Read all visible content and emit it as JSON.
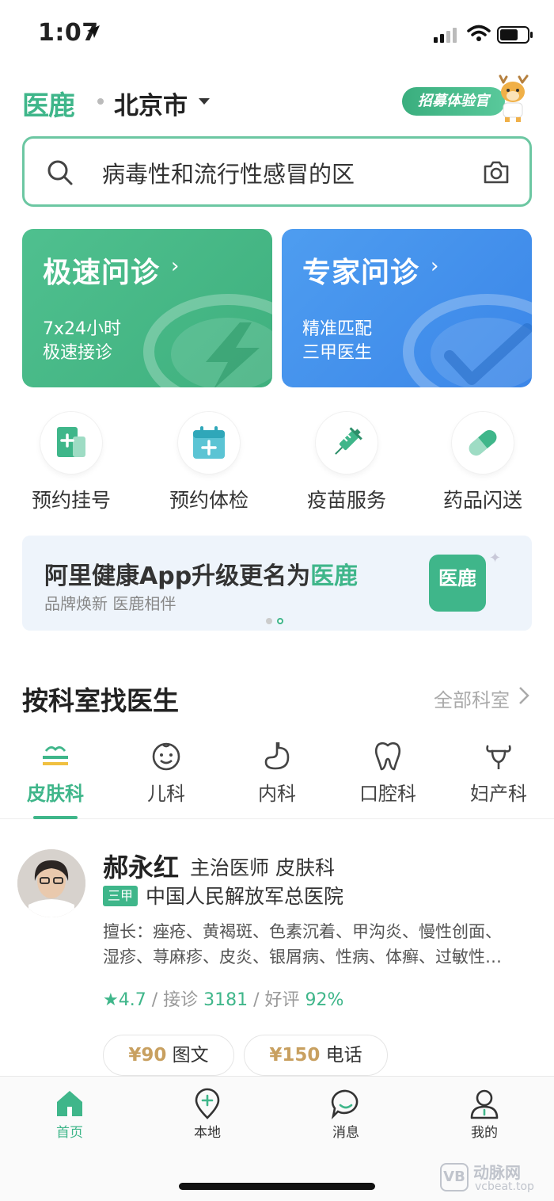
{
  "status_bar": {
    "time": "1:07"
  },
  "header": {
    "logo": "医鹿",
    "city": "北京市",
    "recruit_label": "招募体验官"
  },
  "search": {
    "text": "病毒性和流行性感冒的区"
  },
  "cards": [
    {
      "title": "极速问诊",
      "sub1": "7x24小时",
      "sub2": "极速接诊",
      "color": "#4fc08f"
    },
    {
      "title": "专家问诊",
      "sub1": "精准匹配",
      "sub2": "三甲医生",
      "color": "#4e9df0"
    }
  ],
  "services": [
    {
      "label": "预约挂号",
      "icon": "register-icon"
    },
    {
      "label": "预约体检",
      "icon": "calendar-plus-icon"
    },
    {
      "label": "疫苗服务",
      "icon": "syringe-icon"
    },
    {
      "label": "药品闪送",
      "icon": "pill-icon"
    }
  ],
  "banner": {
    "title": "阿里健康App升级更名为",
    "title_logo": "医鹿",
    "sub": "品牌焕新  医鹿相伴",
    "badge": "医鹿",
    "page_count": 2,
    "active_page": 2
  },
  "dept_section": {
    "title": "按科室找医生",
    "more": "全部科室",
    "tabs": [
      {
        "label": "皮肤科",
        "icon": "skin-icon",
        "active": true
      },
      {
        "label": "儿科",
        "icon": "baby-face-icon",
        "active": false
      },
      {
        "label": "内科",
        "icon": "stomach-icon",
        "active": false
      },
      {
        "label": "口腔科",
        "icon": "tooth-icon",
        "active": false
      },
      {
        "label": "妇产科",
        "icon": "uterus-icon",
        "active": false
      }
    ]
  },
  "doctor": {
    "name": "郝永红",
    "title": "主治医师  皮肤科",
    "tag": "三甲",
    "hospital": "中国人民解放军总医院",
    "skills_line1": "擅长：痤疮、黄褐斑、色素沉着、甲沟炎、慢性创面、",
    "skills_line2": "湿疹、荨麻疹、皮炎、银屑病、性病、体癣、过敏性…",
    "rating": "4.7",
    "rating_sep1": "/ 接诊",
    "consults": "3181",
    "rating_sep2": "/ 好评",
    "positive": "92%",
    "prices": [
      {
        "amount": "¥90",
        "label": "图文"
      },
      {
        "amount": "¥150",
        "label": "电话"
      }
    ]
  },
  "tabbar": [
    {
      "label": "首页",
      "icon": "home-icon",
      "active": true
    },
    {
      "label": "本地",
      "icon": "location-plus-icon",
      "active": false
    },
    {
      "label": "消息",
      "icon": "chat-icon",
      "active": false
    },
    {
      "label": "我的",
      "icon": "user-icon",
      "active": false
    }
  ],
  "watermark": {
    "mark": "VB",
    "cn": "动脉网",
    "en": "vcbeat.top"
  },
  "colors": {
    "brand_green": "#3fb68a",
    "expert_blue": "#4e9df0",
    "price_gold": "#c8a060"
  }
}
